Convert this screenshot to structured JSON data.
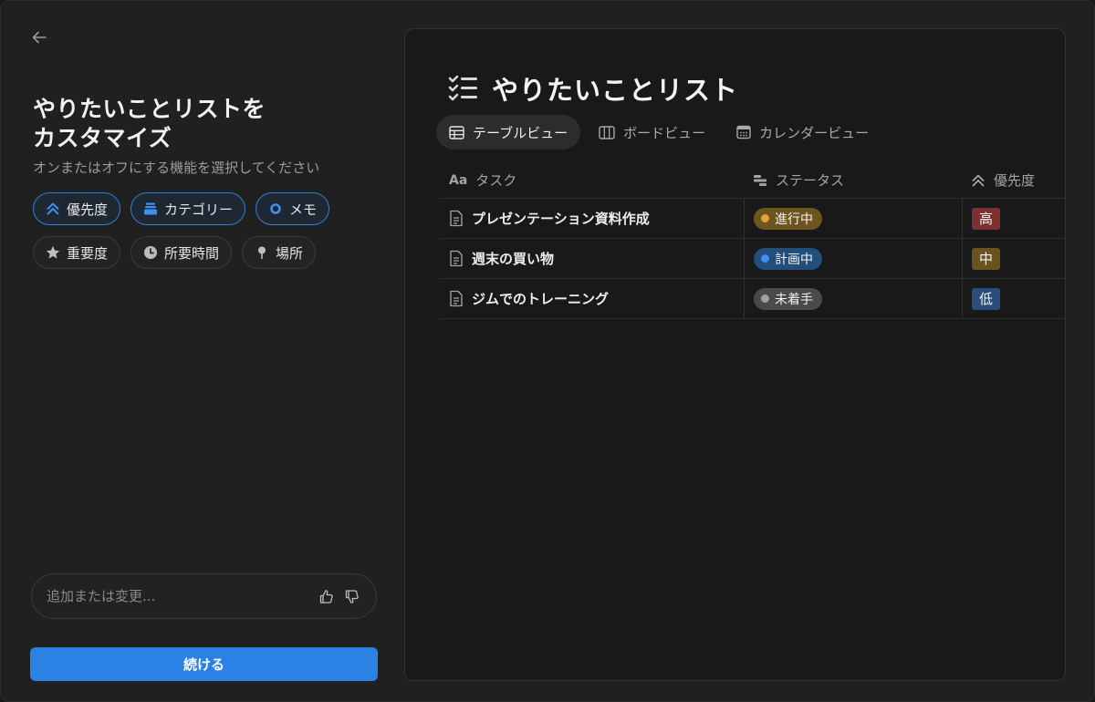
{
  "left": {
    "title": "やりたいことリストをカスタマイズ",
    "subtitle": "オンまたはオフにする機能を選択してください",
    "chips": [
      {
        "label": "優先度",
        "icon": "double-chevron-up-icon",
        "on": true
      },
      {
        "label": "カテゴリー",
        "icon": "stack-icon",
        "on": true
      },
      {
        "label": "メモ",
        "icon": "ring-icon",
        "on": true
      },
      {
        "label": "重要度",
        "icon": "star-icon",
        "on": false
      },
      {
        "label": "所要時間",
        "icon": "clock-icon",
        "on": false
      },
      {
        "label": "場所",
        "icon": "pin-icon",
        "on": false
      }
    ],
    "input": {
      "placeholder": "追加または変更...",
      "value": ""
    },
    "continue_label": "続ける"
  },
  "preview": {
    "title": "やりたいことリスト",
    "views": [
      {
        "label": "テーブルビュー",
        "active": true
      },
      {
        "label": "ボードビュー",
        "active": false
      },
      {
        "label": "カレンダービュー",
        "active": false
      }
    ],
    "columns": {
      "task": "タスク",
      "status": "ステータス",
      "priority": "優先度"
    },
    "rows": [
      {
        "task": "プレゼンテーション資料作成",
        "status": "進行中",
        "priority": "高"
      },
      {
        "task": "週末の買い物",
        "status": "計画中",
        "priority": "中"
      },
      {
        "task": "ジムでのトレーニング",
        "status": "未着手",
        "priority": "低"
      }
    ],
    "task_col_icon_text": "Aa"
  },
  "colors": {
    "accent": "#2a83e4",
    "status_in_progress_bg": "#6e5520",
    "status_in_progress_dot": "#e0a53a",
    "status_planned_bg": "#234d7a",
    "status_planned_dot": "#3d8ff0",
    "status_not_started_bg": "#4a4a4a",
    "status_not_started_dot": "#a0a0a0",
    "priority_high": "#7d3030",
    "priority_mid": "#6b5320",
    "priority_low": "#2a4d7c"
  }
}
